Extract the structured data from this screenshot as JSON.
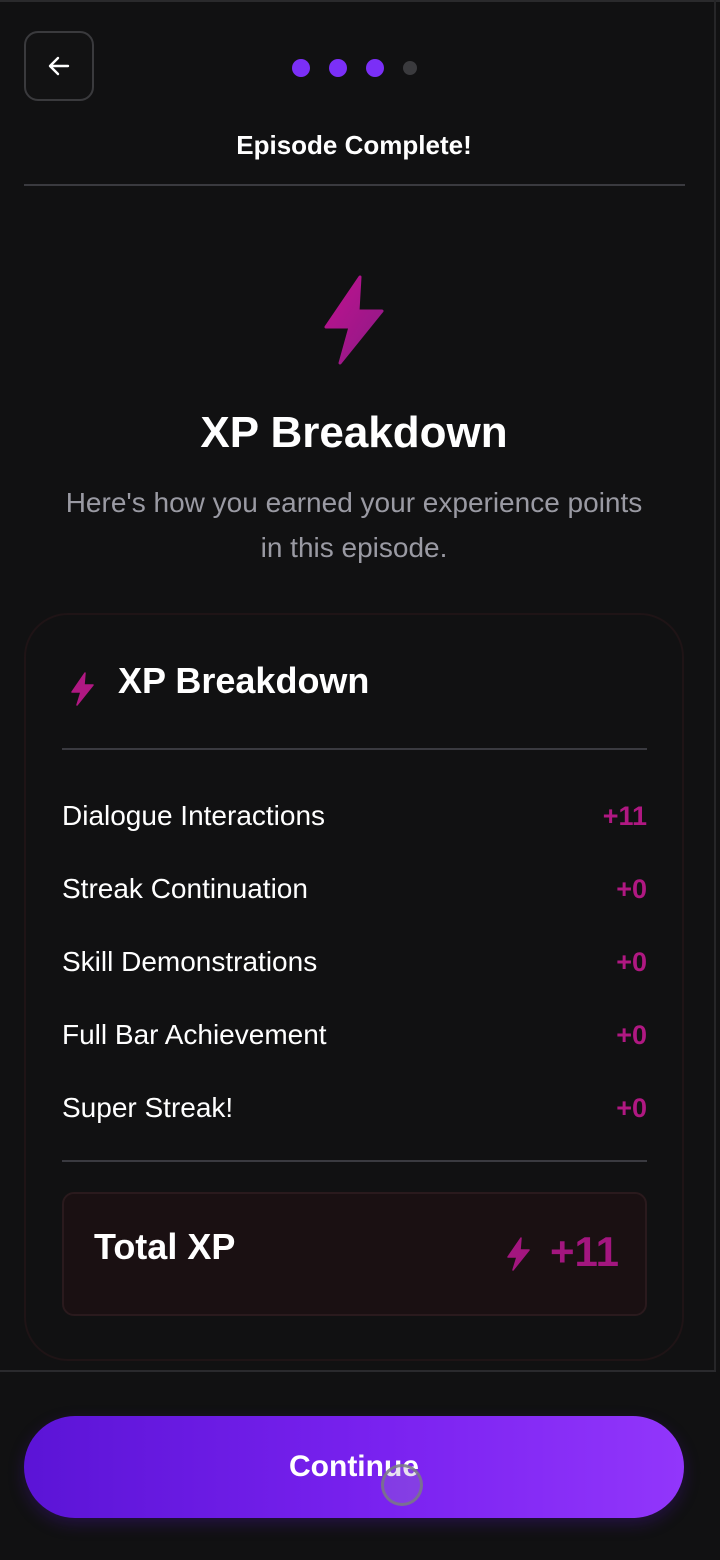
{
  "header": {
    "title": "Episode Complete!",
    "progress": {
      "total_steps": 4,
      "current_step": 3
    }
  },
  "hero": {
    "icon": "lightning-bolt-icon",
    "title": "XP Breakdown",
    "subtitle_line1": "Here's how you earned your experience points",
    "subtitle_line2": "in this episode."
  },
  "card": {
    "icon": "lightning-bolt-icon",
    "title": "XP Breakdown",
    "rows": [
      {
        "label": "Dialogue Interactions",
        "value": "+11"
      },
      {
        "label": "Streak Continuation",
        "value": "+0"
      },
      {
        "label": "Skill Demonstrations",
        "value": "+0"
      },
      {
        "label": "Full Bar Achievement",
        "value": "+0"
      },
      {
        "label": "Super Streak!",
        "value": "+0"
      }
    ],
    "total": {
      "label": "Total XP",
      "value": "+11"
    }
  },
  "footer": {
    "continue_label": "Continue"
  },
  "colors": {
    "accent_purple": "#7b2ff7",
    "accent_magenta": "#b01882",
    "background": "#111112"
  }
}
